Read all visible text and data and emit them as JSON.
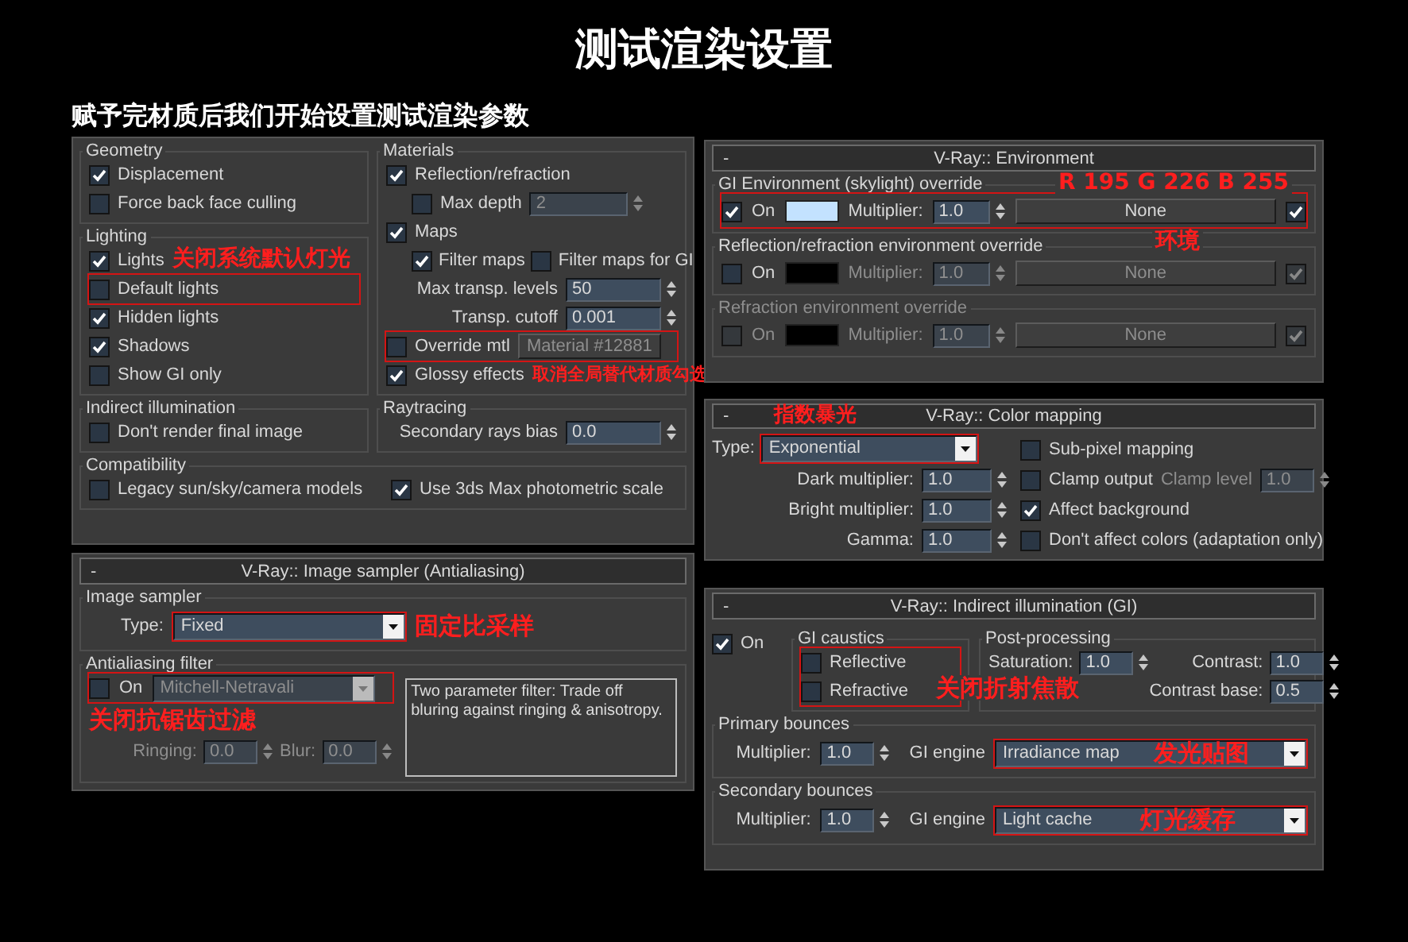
{
  "title": "测试渲染设置",
  "subtitle": "赋予完材质后我们开始设置测试渲染参数",
  "global_switches": {
    "geometry": {
      "title": "Geometry",
      "items": [
        {
          "kind": "check",
          "label": "Displacement",
          "checked": true
        },
        {
          "kind": "check",
          "label": "Force back face culling",
          "checked": false
        }
      ]
    },
    "lighting": {
      "title": "Lighting",
      "items": [
        {
          "kind": "check",
          "label": "Lights",
          "checked": true,
          "note": "关闭系统默认灯光"
        },
        {
          "kind": "check",
          "label": "Default lights",
          "checked": false,
          "highlighted": true
        },
        {
          "kind": "check",
          "label": "Hidden lights",
          "checked": true
        },
        {
          "kind": "check",
          "label": "Shadows",
          "checked": true
        },
        {
          "kind": "check",
          "label": "Show GI only",
          "checked": false
        }
      ]
    },
    "indirect_illumination": {
      "title": "Indirect illumination",
      "items": [
        {
          "kind": "check",
          "label": "Don't render final image",
          "checked": false
        }
      ]
    },
    "materials": {
      "title": "Materials",
      "items": [
        {
          "kind": "check",
          "label": "Reflection/refraction",
          "checked": true
        },
        {
          "kind": "sub_check",
          "label": "Max depth",
          "checked": false,
          "value": "2"
        },
        {
          "kind": "check",
          "label": "Maps",
          "checked": true
        },
        {
          "kind": "check_pair",
          "checks": [
            {
              "label": "Filter maps",
              "checked": true
            },
            {
              "label": "Filter maps for GI",
              "checked": false
            }
          ]
        },
        {
          "kind": "spin",
          "label": "Max transp. levels",
          "value": "50"
        },
        {
          "kind": "spin",
          "label": "Transp. cutoff",
          "value": "0.001"
        },
        {
          "kind": "check_button",
          "label": "Override mtl",
          "checked": false,
          "button": "Material #12881",
          "highlighted": true
        },
        {
          "kind": "check",
          "label": "Glossy effects",
          "checked": true,
          "note": "取消全局替代材质勾选"
        }
      ]
    },
    "raytracing": {
      "title": "Raytracing",
      "items": [
        {
          "kind": "spin",
          "label": "Secondary rays bias",
          "value": "0.0"
        }
      ]
    },
    "compatibility": {
      "title": "Compatibility",
      "items": [
        {
          "kind": "check",
          "label": "Legacy sun/sky/camera models",
          "checked": false
        },
        {
          "kind": "check",
          "label": "Use 3ds Max photometric scale",
          "checked": true
        }
      ]
    }
  },
  "image_sampler": {
    "toggle": "-",
    "header": "V-Ray:: Image sampler (Antialiasing)",
    "sampler": {
      "title": "Image sampler",
      "type_label": "Type:",
      "type": "Fixed",
      "highlighted": true,
      "note": "固定比采样"
    },
    "filter": {
      "title": "Antialiasing filter",
      "on_label": "On",
      "on": false,
      "type": "Mitchell-Netravali",
      "highlighted": true,
      "note": "关闭抗锯齿过滤",
      "params": [
        {
          "label": "Ringing:",
          "value": "0.0"
        },
        {
          "label": "Blur:",
          "value": "0.0"
        }
      ],
      "description": "Two parameter filter: Trade off bluring against ringing & anisotropy."
    }
  },
  "environment": {
    "toggle": "-",
    "header": "V-Ray:: Environment",
    "note": "R 195 G 226 B 255",
    "overrides": [
      {
        "title": "GI Environment (skylight) override",
        "on_label": "On",
        "on": true,
        "color": "#c3e2ff",
        "multiplier_label": "Multiplier:",
        "multiplier": "1.0",
        "map": "None",
        "map_on": true,
        "highlighted": true,
        "note": "环境"
      },
      {
        "title": "Reflection/refraction environment override",
        "on_label": "On",
        "on": false,
        "color": "#000000",
        "multiplier_label": "Multiplier:",
        "multiplier": "1.0",
        "map": "None",
        "map_on": true
      },
      {
        "title": "Refraction environment override",
        "on_label": "On",
        "on": false,
        "color": "#000000",
        "multiplier_label": "Multiplier:",
        "multiplier": "1.0",
        "map": "None",
        "map_on": true,
        "disabled": true
      }
    ]
  },
  "color_mapping": {
    "toggle": "-",
    "header": "V-Ray:: Color mapping",
    "note": "指数暴光",
    "type_label": "Type:",
    "type": "Exponential",
    "highlighted": true,
    "spins": [
      {
        "label": "Dark multiplier:",
        "value": "1.0"
      },
      {
        "label": "Bright multiplier:",
        "value": "1.0"
      },
      {
        "label": "Gamma:",
        "value": "1.0"
      }
    ],
    "checks": [
      {
        "kind": "check",
        "label": "Sub-pixel mapping",
        "checked": false
      },
      {
        "kind": "clamp",
        "label": "Clamp output",
        "checked": false,
        "level_label": "Clamp level",
        "level": "1.0"
      },
      {
        "kind": "check",
        "label": "Affect background",
        "checked": true
      },
      {
        "kind": "check",
        "label": "Don't affect colors (adaptation only)",
        "checked": false
      }
    ]
  },
  "gi": {
    "toggle": "-",
    "header": "V-Ray:: Indirect illumination (GI)",
    "on_label": "On",
    "on": true,
    "caustics": {
      "title": "GI caustics",
      "items": [
        {
          "label": "Reflective",
          "checked": false
        },
        {
          "label": "Refractive",
          "checked": false
        }
      ],
      "highlighted": true,
      "note": "关闭折射焦散"
    },
    "post": {
      "title": "Post-processing",
      "items": [
        {
          "label": "Saturation:",
          "value": "1.0"
        },
        {
          "label": "Contrast:",
          "value": "1.0"
        },
        {
          "label": "Contrast base:",
          "value": "0.5"
        }
      ]
    },
    "bounces": [
      {
        "title": "Primary bounces",
        "multiplier_label": "Multiplier:",
        "multiplier": "1.0",
        "engine_label": "GI engine",
        "engine": "Irradiance map",
        "note": "发光贴图"
      },
      {
        "title": "Secondary bounces",
        "multiplier_label": "Multiplier:",
        "multiplier": "1.0",
        "engine_label": "GI engine",
        "engine": "Light cache",
        "note": "灯光缓存"
      }
    ],
    "engines_highlighted": true
  }
}
